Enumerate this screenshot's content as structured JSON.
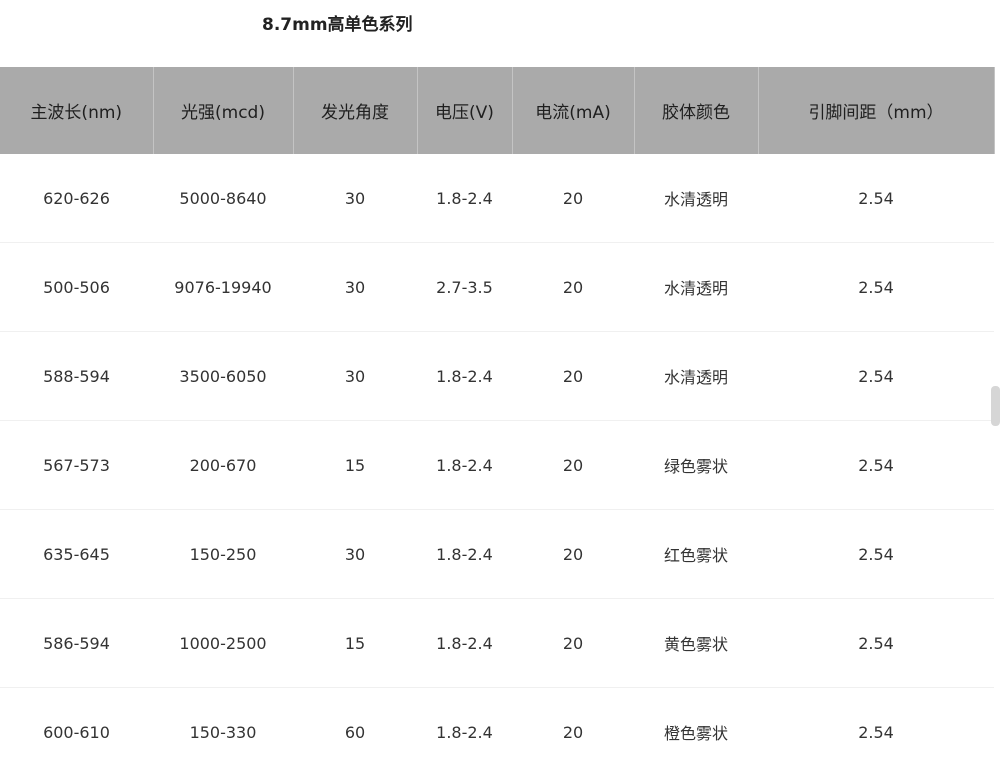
{
  "title": "8.7mm高单色系列",
  "table": {
    "headers": [
      "主波长(nm)",
      "光强(mcd)",
      "发光角度",
      "电压(V)",
      "电流(mA)",
      "胶体颜色",
      "引脚间距（mm）"
    ],
    "rows": [
      [
        "620-626",
        "5000-8640",
        "30",
        "1.8-2.4",
        "20",
        "水清透明",
        "2.54"
      ],
      [
        "500-506",
        "9076-19940",
        "30",
        "2.7-3.5",
        "20",
        "水清透明",
        "2.54"
      ],
      [
        "588-594",
        "3500-6050",
        "30",
        "1.8-2.4",
        "20",
        "水清透明",
        "2.54"
      ],
      [
        "567-573",
        "200-670",
        "15",
        "1.8-2.4",
        "20",
        "绿色雾状",
        "2.54"
      ],
      [
        "635-645",
        "150-250",
        "30",
        "1.8-2.4",
        "20",
        "红色雾状",
        "2.54"
      ],
      [
        "586-594",
        "1000-2500",
        "15",
        "1.8-2.4",
        "20",
        "黄色雾状",
        "2.54"
      ],
      [
        "600-610",
        "150-330",
        "60",
        "1.8-2.4",
        "20",
        "橙色雾状",
        "2.54"
      ]
    ]
  },
  "colors": {
    "header_background": "#aaaaaa",
    "row_divider": "#f0f0f0",
    "text": "#333333"
  }
}
